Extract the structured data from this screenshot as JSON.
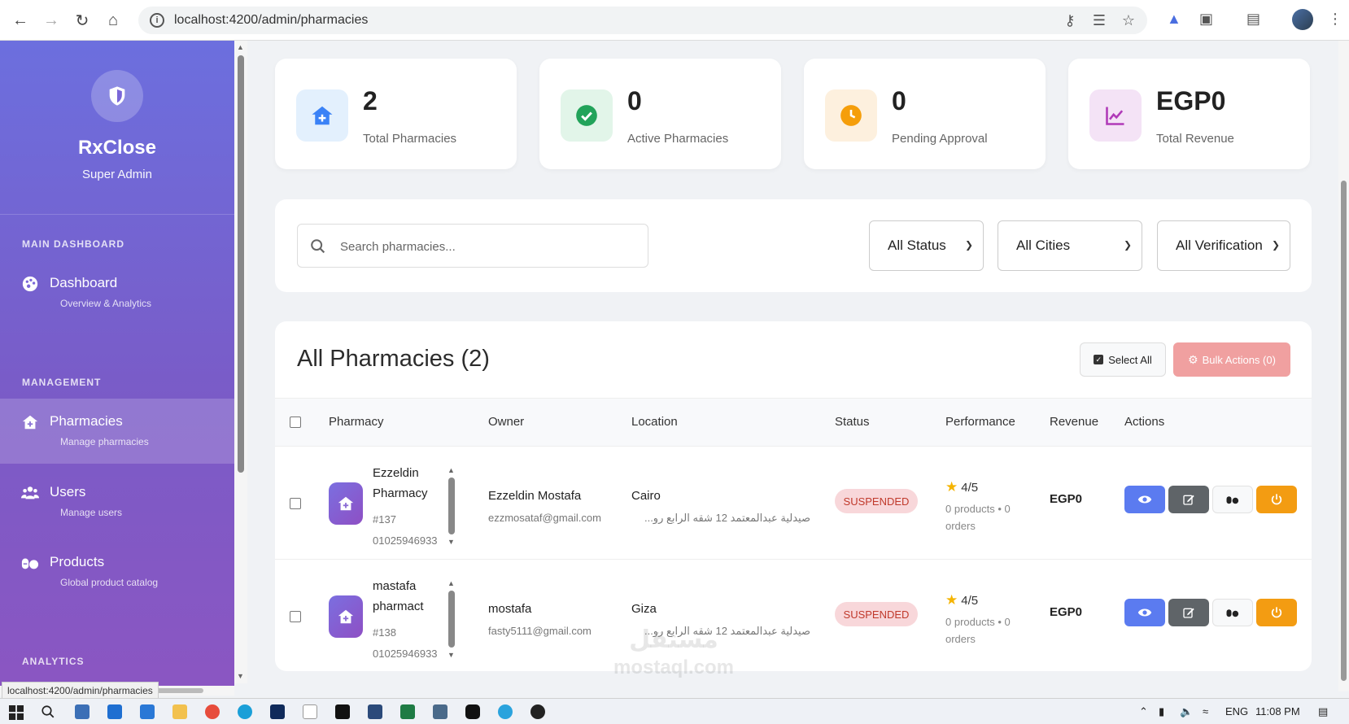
{
  "browser": {
    "url": "localhost:4200/admin/pharmacies",
    "status_url": "localhost:4200/admin/pharmacies"
  },
  "sidebar": {
    "brand": "RxClose",
    "role": "Super Admin",
    "sections": {
      "main": "MAIN DASHBOARD",
      "management": "MANAGEMENT",
      "analytics": "ANALYTICS"
    },
    "items": [
      {
        "label": "Dashboard",
        "sub": "Overview & Analytics",
        "icon": "palette-icon"
      },
      {
        "label": "Pharmacies",
        "sub": "Manage pharmacies",
        "icon": "clinic-icon"
      },
      {
        "label": "Users",
        "sub": "Manage users",
        "icon": "users-icon"
      },
      {
        "label": "Products",
        "sub": "Global product catalog",
        "icon": "pills-icon"
      }
    ]
  },
  "stats": [
    {
      "value": "2",
      "label": "Total Pharmacies",
      "color": "#3b82f6",
      "bg": "#e3f0fd"
    },
    {
      "value": "0",
      "label": "Active Pharmacies",
      "color": "#22a35a",
      "bg": "#e2f5e9"
    },
    {
      "value": "0",
      "label": "Pending Approval",
      "color": "#f59e0b",
      "bg": "#fdf0de"
    },
    {
      "value": "EGP0",
      "label": "Total Revenue",
      "color": "#b03ab8",
      "bg": "#f4e3f6"
    }
  ],
  "filters": {
    "search_placeholder": "Search pharmacies...",
    "status": "All Status",
    "cities": "All Cities",
    "verification": "All Verification"
  },
  "table": {
    "title": "All Pharmacies (2)",
    "select_all": "Select All",
    "bulk_actions": "Bulk Actions (0)",
    "headers": [
      "Pharmacy",
      "Owner",
      "Location",
      "Status",
      "Performance",
      "Revenue",
      "Actions"
    ],
    "rows": [
      {
        "name": "Ezzeldin Pharmacy",
        "id": "#137",
        "phone": "01025946933",
        "owner": "Ezzeldin Mostafa",
        "email": "ezzmosataf@gmail.com",
        "city": "Cairo",
        "address": "صيدلية عبدالمعتمد 12 شقه الرابع رو...",
        "status": "SUSPENDED",
        "rating": "4/5",
        "stats": "0 products • 0 orders",
        "revenue": "EGP0"
      },
      {
        "name": "mastafa pharmact",
        "id": "#138",
        "phone": "01025946933",
        "owner": "mostafa",
        "email": "fasty5111@gmail.com",
        "city": "Giza",
        "address": "صيدلية عبدالمعتمد 12 شقه الرابع رو...",
        "status": "SUSPENDED",
        "rating": "4/5",
        "stats": "0 products • 0 orders",
        "revenue": "EGP0"
      }
    ]
  },
  "taskbar": {
    "lang": "ENG",
    "time": "11:08 PM"
  },
  "watermark": {
    "arabic": "مستقل",
    "latin": "mostaql.com"
  }
}
